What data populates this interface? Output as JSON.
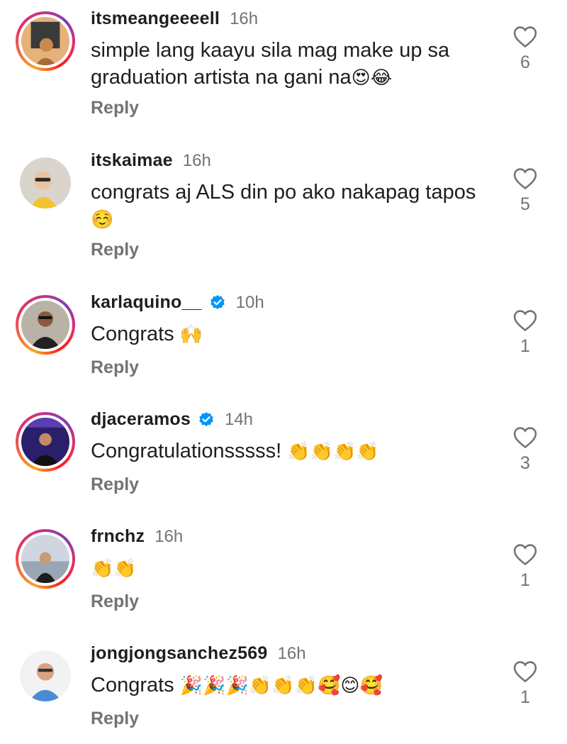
{
  "comments": [
    {
      "username": "itsmeangeeeell",
      "time": "16h",
      "text": "simple lang kaayu sila mag make up sa graduation artista na gani na",
      "emojis": "😍😂",
      "reply_label": "Reply",
      "likes": "6",
      "verified": false,
      "story_ring": true
    },
    {
      "username": "itskaimae",
      "time": "16h",
      "text": "congrats aj ALS din po ako nakapag tapos",
      "emojis": "☺️",
      "reply_label": "Reply",
      "likes": "5",
      "verified": false,
      "story_ring": false
    },
    {
      "username": "karlaquino__",
      "time": "10h",
      "text": "Congrats",
      "emojis": "🙌",
      "reply_label": "Reply",
      "likes": "1",
      "verified": true,
      "story_ring": true
    },
    {
      "username": "djaceramos",
      "time": "14h",
      "text": "Congratulationsssss!",
      "emojis": "👏👏👏👏",
      "reply_label": "Reply",
      "likes": "3",
      "verified": true,
      "story_ring": true
    },
    {
      "username": "frnchz",
      "time": "16h",
      "text": "",
      "emojis": "👏👏",
      "reply_label": "Reply",
      "likes": "1",
      "verified": false,
      "story_ring": true
    },
    {
      "username": "jongjongsanchez569",
      "time": "16h",
      "text": "Congrats",
      "emojis": "🎉🎉🎉👏👏👏🥰😊🥰",
      "reply_label": "Reply",
      "likes": "1",
      "verified": false,
      "story_ring": false
    }
  ],
  "icons": {
    "like": "heart-outline-icon",
    "verified": "verified-badge-icon"
  },
  "colors": {
    "verified_blue": "#0095f6",
    "muted_text": "#737373",
    "primary_text": "#1c1e21"
  }
}
